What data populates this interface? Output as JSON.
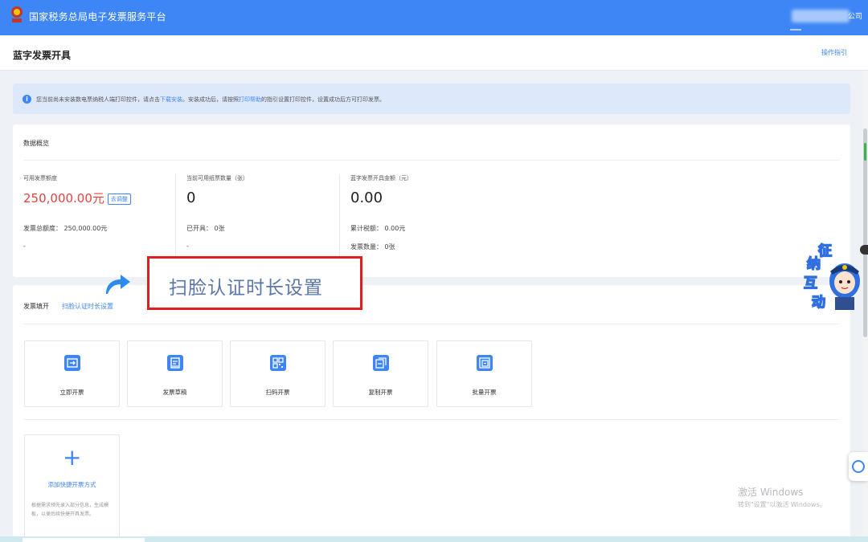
{
  "topbar": {
    "title": "国家税务总局电子发票服务平台",
    "user_suffix": "公司"
  },
  "header": {
    "title": "蓝字发票开具",
    "guide_link": "操作指引"
  },
  "notice": {
    "icon": "info-icon",
    "text_before": "您当前尚未安装数电票纳税人端打印控件，请点击",
    "link_download": "下载安装",
    "text_middle": "。安装成功后，请按照",
    "link_help": "打印帮助",
    "text_after": "的指引设置打印控件，设置成功后方可打印发票。"
  },
  "overview": {
    "title": "数据概览",
    "columns": [
      {
        "label": "可用发票额度",
        "value": "250,000.00元",
        "action": "去调整",
        "line1": "发票总额度：  250,000.00元",
        "line2": "-"
      },
      {
        "label": "当前可用纸票数量（张）",
        "value": "0",
        "line1": "已开具：  0张",
        "line2": "-"
      },
      {
        "label": "蓝字发票开具金额（元）",
        "value": "0.00",
        "line1": "累计税额：  0.00元",
        "line2": "发票数量：  0张"
      }
    ]
  },
  "fill": {
    "title": "发票填开",
    "link": "扫脸认证时长设置",
    "tiles": [
      {
        "label": "立即开票",
        "icon": "invoice-now-icon"
      },
      {
        "label": "发票草稿",
        "icon": "draft-icon"
      },
      {
        "label": "扫码开票",
        "icon": "qr-code-icon"
      },
      {
        "label": "复制开票",
        "icon": "copy-invoice-icon"
      },
      {
        "label": "批量开票",
        "icon": "batch-invoice-icon"
      }
    ],
    "add": {
      "title": "添加快捷开票方式",
      "desc": "根据需求预先录入部分信息，生成模板，以便后续快捷开具发票。"
    }
  },
  "callout": {
    "text": "扫脸认证时长设置"
  },
  "mascot": {
    "chars": [
      "征",
      "纳",
      "互",
      "动"
    ]
  },
  "watermark": {
    "title": "激活 Windows",
    "sub": "转到\"设置\"以激活 Windows。"
  },
  "colors": {
    "brand": "#3e86f5",
    "quota_red": "#e64340",
    "callout_border": "#e02020"
  }
}
